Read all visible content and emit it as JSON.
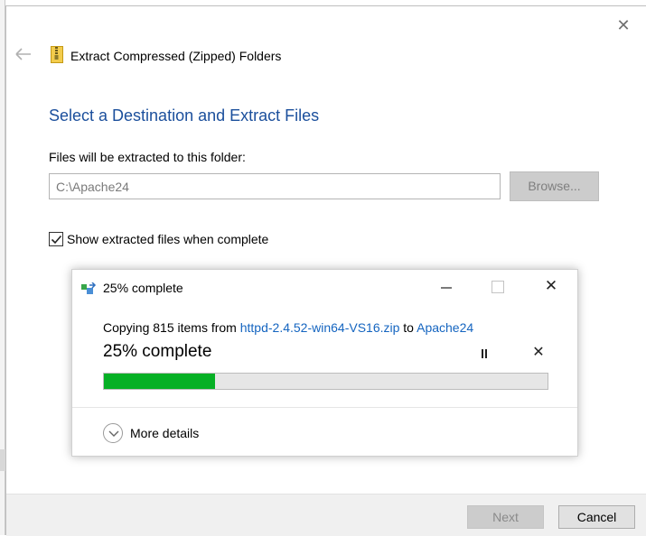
{
  "wizard": {
    "title": "Extract Compressed (Zipped) Folders",
    "heading": "Select a Destination and Extract Files",
    "destination_label": "Files will be extracted to this folder:",
    "destination_value": "C:\\Apache24",
    "browse_label": "Browse...",
    "show_files_label": "Show extracted files when complete",
    "show_files_checked": true,
    "next_label": "Next",
    "cancel_label": "Cancel"
  },
  "progress": {
    "title": "25% complete",
    "copy_prefix": "Copying 815 items from",
    "source": "httpd-2.4.52-win64-VS16.zip",
    "copy_to": "to",
    "destination": "Apache24",
    "status": "25% complete",
    "percent": 25,
    "more_details_label": "More details"
  },
  "icons": {
    "back": "back-arrow-icon",
    "zip": "zip-folder-icon",
    "close": "close-icon",
    "copy": "copy-icon",
    "minimize": "minimize-icon",
    "maximize": "maximize-icon",
    "pause": "pause-icon",
    "chevron": "chevron-down-icon"
  },
  "colors": {
    "heading": "#1b4f9c",
    "link": "#1565c0",
    "progress_fill": "#06b025",
    "progress_track": "#e6e6e6"
  }
}
